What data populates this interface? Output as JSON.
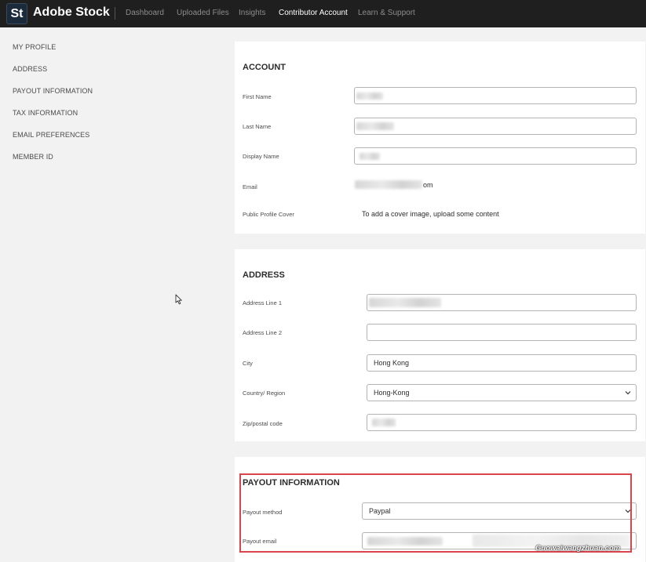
{
  "header": {
    "logo_badge": "St",
    "logo_text": "Adobe Stock",
    "nav": [
      "Dashboard",
      "Uploaded Files",
      "Insights",
      "Contributor Account",
      "Learn & Support"
    ],
    "active_nav": "Contributor Account"
  },
  "sidebar": {
    "items": [
      "MY PROFILE",
      "ADDRESS",
      "PAYOUT INFORMATION",
      "TAX INFORMATION",
      "EMAIL PREFERENCES",
      "MEMBER ID"
    ]
  },
  "account": {
    "title": "ACCOUNT",
    "first_name_label": "First Name",
    "last_name_label": "Last Name",
    "display_name_label": "Display Name",
    "email_label": "Email",
    "email_value_suffix": "om",
    "cover_label": "Public Profile Cover",
    "cover_text": "To add a cover image, upload some content"
  },
  "address": {
    "title": "ADDRESS",
    "line1_label": "Address Line 1",
    "line2_label": "Address Line 2",
    "city_label": "City",
    "city_value": "Hong Kong",
    "country_label": "Country/ Region",
    "country_value": "Hong-Kong",
    "zip_label": "Zip/postal code"
  },
  "payout": {
    "title": "PAYOUT INFORMATION",
    "method_label": "Payout method",
    "method_value": "Paypal",
    "email_label": "Payout email"
  },
  "watermark": "Guowaiwangzhuan.com",
  "colors": {
    "topbar": "#1f1f1f",
    "highlight": "#d9454b",
    "background": "#f2f2f2"
  }
}
